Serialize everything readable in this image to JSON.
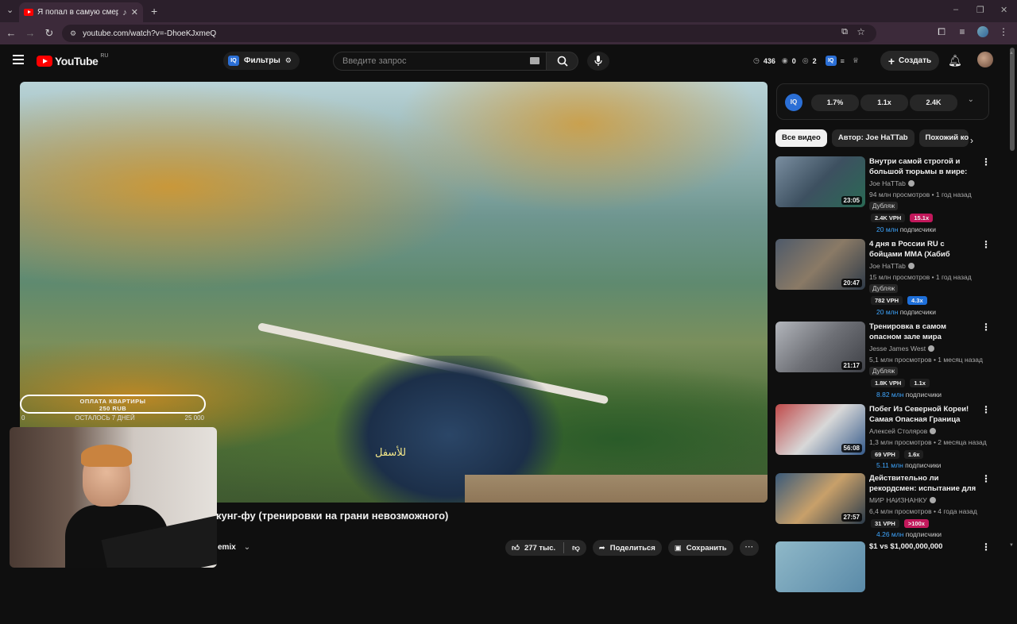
{
  "browser": {
    "tab_title": "Я попал в самую смертонос",
    "url": "youtube.com/watch?v=-DhoeKJxmeQ"
  },
  "header": {
    "logo_text": "YouTube",
    "region": "RU",
    "filters_label": "Фильтры",
    "search_placeholder": "Введите запрос",
    "stats": {
      "views": "436",
      "a": "0",
      "b": "2"
    },
    "create_label": "Создать"
  },
  "player": {
    "subtitle_text": "للأسفل",
    "donation_title": "ОПЛАТА КВАРТИРЫ",
    "donation_amount": "250 RUB",
    "donation_left": "0",
    "donation_remaining": "ОСТАЛОСЬ 7 ДНЕЙ",
    "donation_goal": "25 000"
  },
  "video": {
    "title_fragment": "кунг-фу (тренировки на грани невозможного)",
    "channel_fragment": "emix",
    "likes": "277 тыс.",
    "share_label": "Поделиться",
    "save_label": "Сохранить"
  },
  "iq_panel": {
    "logo": "IQ",
    "metrics": [
      "1.7%",
      "1.1x",
      "2.4K"
    ]
  },
  "chips": [
    "Все видео",
    "Автор: Joe HaTTab",
    "Похожий ко"
  ],
  "recommendations": [
    {
      "title": "Внутри самой строгой и большой тюрьмы в мире: ка...",
      "channel": "Joe HaTTab",
      "meta": "94 млн просмотров • 1 год назад",
      "dub": "Дубляж",
      "duration": "23:05",
      "vph": "2.4K VPH",
      "mult": "15.1x",
      "mult_color": "#c2185b",
      "subs": "20 млн",
      "subs_word": "подписчики"
    },
    {
      "title": "4 дня в России RU с бойцами MMA (Хабиб Нурмагомедов, ...",
      "channel": "Joe HaTTab",
      "meta": "15 млн просмотров • 1 год назад",
      "dub": "Дубляж",
      "duration": "20:47",
      "vph": "782 VPH",
      "mult": "4.3x",
      "mult_color": "#1e6fd9",
      "subs": "20 млн",
      "subs_word": "подписчики"
    },
    {
      "title": "Тренировка в самом опасном зале мира (Diamond Gym)",
      "channel": "Jesse James West",
      "meta": "5,1 млн просмотров • 1 месяц назад",
      "dub": "Дубляж",
      "duration": "21:17",
      "vph": "1.8K VPH",
      "mult": "1.1x",
      "mult_color": "#1f1f1f",
      "subs": "8.82 млн",
      "subs_word": "подписчики"
    },
    {
      "title": "Побег Из Северной Кореи! Самая Опасная Граница КН...",
      "channel": "Алексей Столяров",
      "meta": "1,3 млн просмотров • 2 месяца назад",
      "dub": "",
      "duration": "56:08",
      "vph": "69 VPH",
      "mult": "1.6x",
      "mult_color": "#1f1f1f",
      "subs": "5.11 млн",
      "subs_word": "подписчики"
    },
    {
      "title": "Действительно ли рекордсмен: испытание для ...",
      "channel": "МИР НАИЗНАНКУ",
      "meta": "6,4 млн просмотров • 4 года назад",
      "dub": "",
      "duration": "27:57",
      "vph": "31 VPH",
      "mult": ">100x",
      "mult_color": "#c2185b",
      "subs": "4.26 млн",
      "subs_word": "подписчики"
    },
    {
      "title": "$1 vs $1,000,000,000",
      "channel": "",
      "meta": "",
      "dub": "",
      "duration": "",
      "vph": "",
      "mult": "",
      "mult_color": "#1f1f1f",
      "subs": "",
      "subs_word": ""
    }
  ]
}
